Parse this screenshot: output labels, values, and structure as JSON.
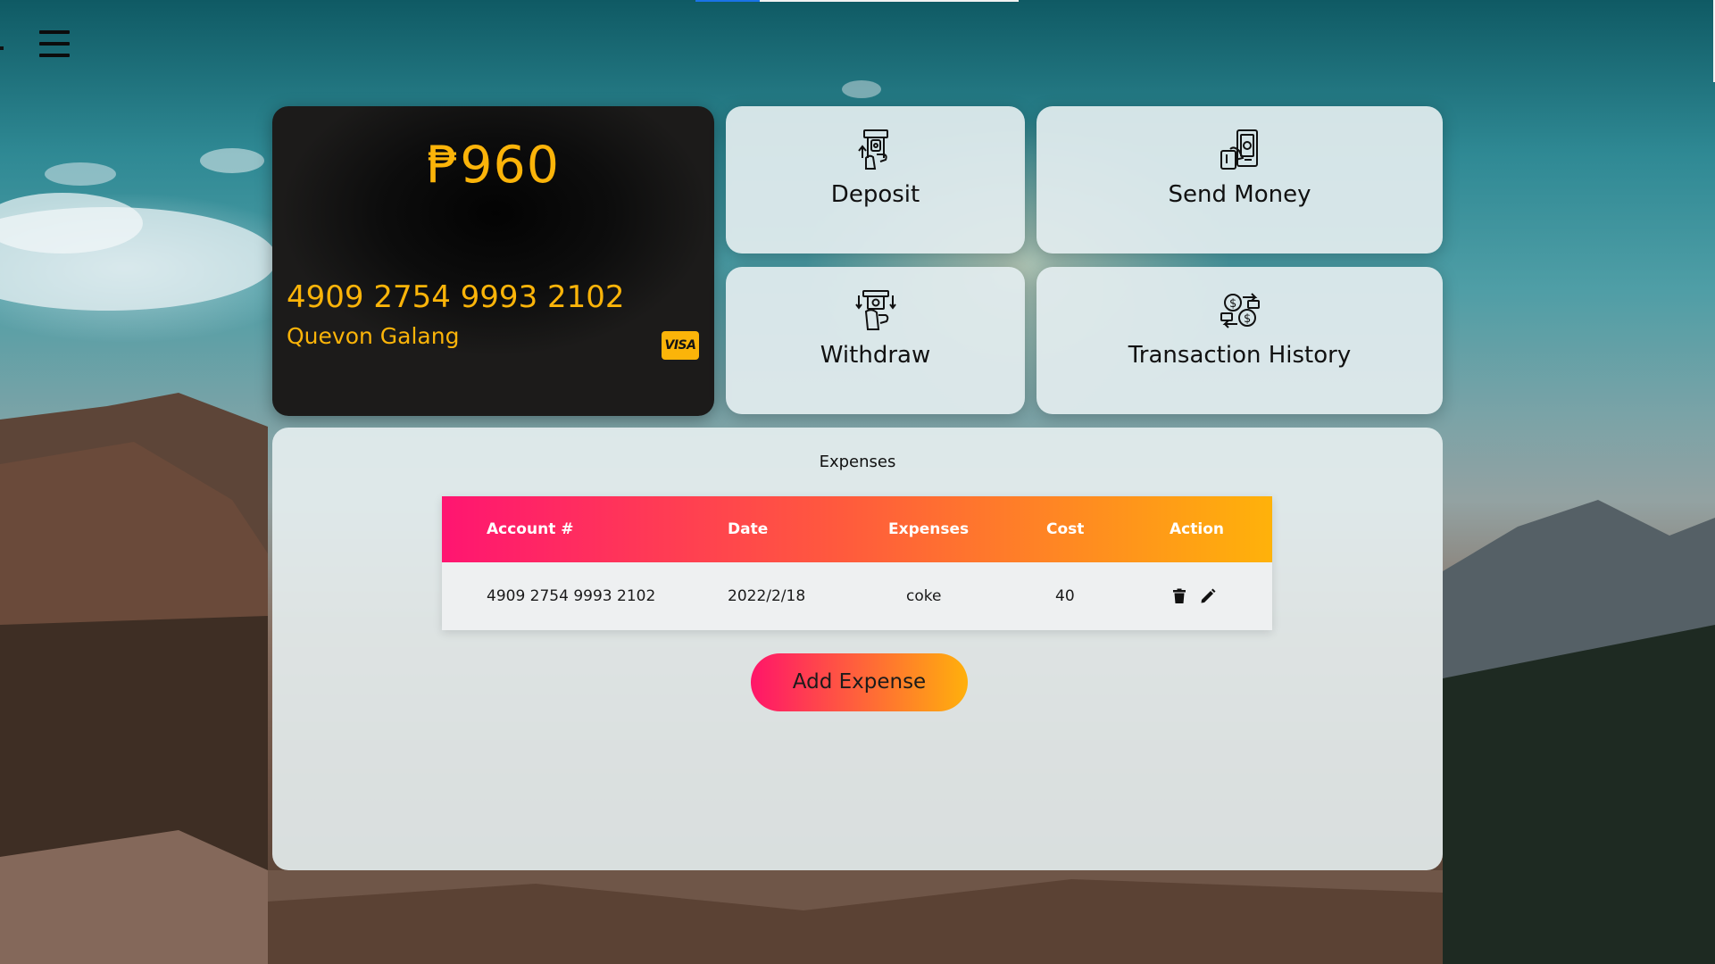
{
  "colors": {
    "accent_gold": "#fbb409",
    "card_bg": "#0a0a0a",
    "gradient_pink": "#ff1571",
    "gradient_orange": "#ffb20a",
    "tile_bg": "#e2ecee"
  },
  "nav": {
    "menu_icon": "hamburger-menu-icon"
  },
  "card": {
    "balance": "₱960",
    "number": "4909 2754 9993 2102",
    "holder": "Quevon Galang",
    "brand": "VISA"
  },
  "actions": [
    {
      "label": "Deposit",
      "icon": "deposit-icon"
    },
    {
      "label": "Send Money",
      "icon": "send-money-icon"
    },
    {
      "label": "Withdraw",
      "icon": "withdraw-icon"
    },
    {
      "label": "Transaction History",
      "icon": "transaction-history-icon"
    }
  ],
  "expenses": {
    "title": "Expenses",
    "columns": [
      "Account #",
      "Date",
      "Expenses",
      "Cost",
      "Action"
    ],
    "rows": [
      {
        "account": "4909 2754 9993 2102",
        "date": "2022/2/18",
        "expense": "coke",
        "cost": "40",
        "actions": [
          "trash-icon",
          "pencil-icon"
        ]
      }
    ],
    "add_button": "Add Expense"
  }
}
